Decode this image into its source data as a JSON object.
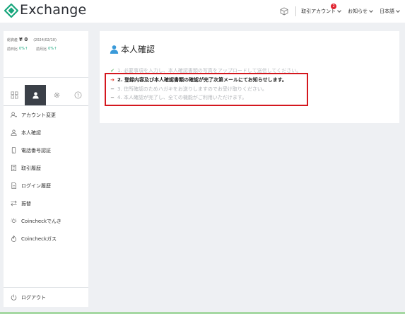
{
  "header": {
    "logo_text": "Exchange",
    "account_label": "取引アカウント",
    "account_badge": "2",
    "notifications_label": "お知らせ",
    "language_label": "日本語"
  },
  "balance": {
    "total_label": "総資産",
    "total_value": "¥ 0",
    "date": "(2024/02/10)",
    "day_change_label": "前日比",
    "day_change_value": "0%↑",
    "month_change_label": "前月比",
    "month_change_value": "0%↑"
  },
  "sidebar": {
    "items": [
      {
        "label": "アカウント変更",
        "icon": "user-switch-icon"
      },
      {
        "label": "本人確認",
        "icon": "user-icon"
      },
      {
        "label": "電話番号認証",
        "icon": "phone-icon"
      },
      {
        "label": "取引履歴",
        "icon": "document-icon"
      },
      {
        "label": "ログイン履歴",
        "icon": "file-icon"
      },
      {
        "label": "振替",
        "icon": "transfer-icon"
      },
      {
        "label": "Coincheckでんき",
        "icon": "bulb-icon"
      },
      {
        "label": "Coincheckガス",
        "icon": "flame-icon"
      }
    ],
    "logout_label": "ログアウト"
  },
  "main": {
    "title": "本人確認",
    "steps": [
      {
        "mark": "✔",
        "text": "1. 必要事項を入力し、本人確認書類の写真をアップロードして送信してください。"
      },
      {
        "mark": "➔",
        "text": "2. 登録内容及び本人確認書類の確認が完了次第メールにてお知らせします。"
      },
      {
        "mark": "━",
        "text": "3. 住所確認のためハガキをお送りしますのでお受け取りください。"
      },
      {
        "mark": "━",
        "text": "4. 本人確認が完了し、全ての機能がご利用いただけます。"
      }
    ]
  },
  "colors": {
    "brand": "#17a67c",
    "highlight": "#d4171e",
    "active_tab": "#3b4048"
  }
}
